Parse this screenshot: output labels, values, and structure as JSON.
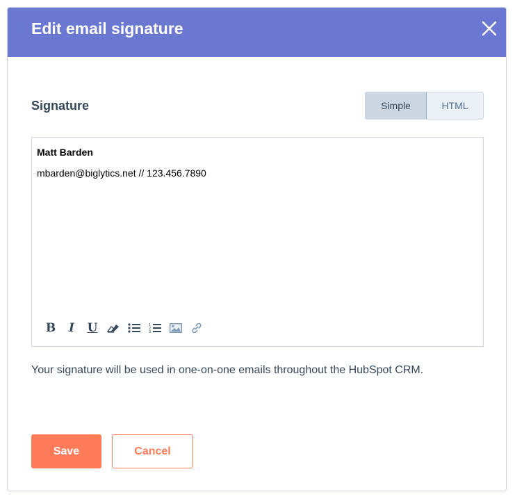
{
  "dialog": {
    "title": "Edit email signature",
    "close_icon": "close-icon"
  },
  "signature": {
    "label": "Signature",
    "modes": [
      {
        "label": "Simple",
        "selected": true
      },
      {
        "label": "HTML",
        "selected": false
      }
    ],
    "content": {
      "name": "Matt Barden",
      "line": "mbarden@biglytics.net // 123.456.7890"
    },
    "toolbar": [
      {
        "name": "bold-icon",
        "glyph": "B"
      },
      {
        "name": "italic-icon",
        "glyph": "I"
      },
      {
        "name": "underline-icon",
        "glyph": "U"
      },
      {
        "name": "eraser-icon"
      },
      {
        "name": "bulleted-list-icon"
      },
      {
        "name": "numbered-list-icon"
      },
      {
        "name": "image-icon"
      },
      {
        "name": "link-icon"
      }
    ],
    "helper_text": "Your signature will be used in one-on-one emails throughout the HubSpot CRM."
  },
  "actions": {
    "save_label": "Save",
    "cancel_label": "Cancel"
  },
  "colors": {
    "header": "#6a78d1",
    "primary": "#ff7a59",
    "text": "#33475b"
  }
}
